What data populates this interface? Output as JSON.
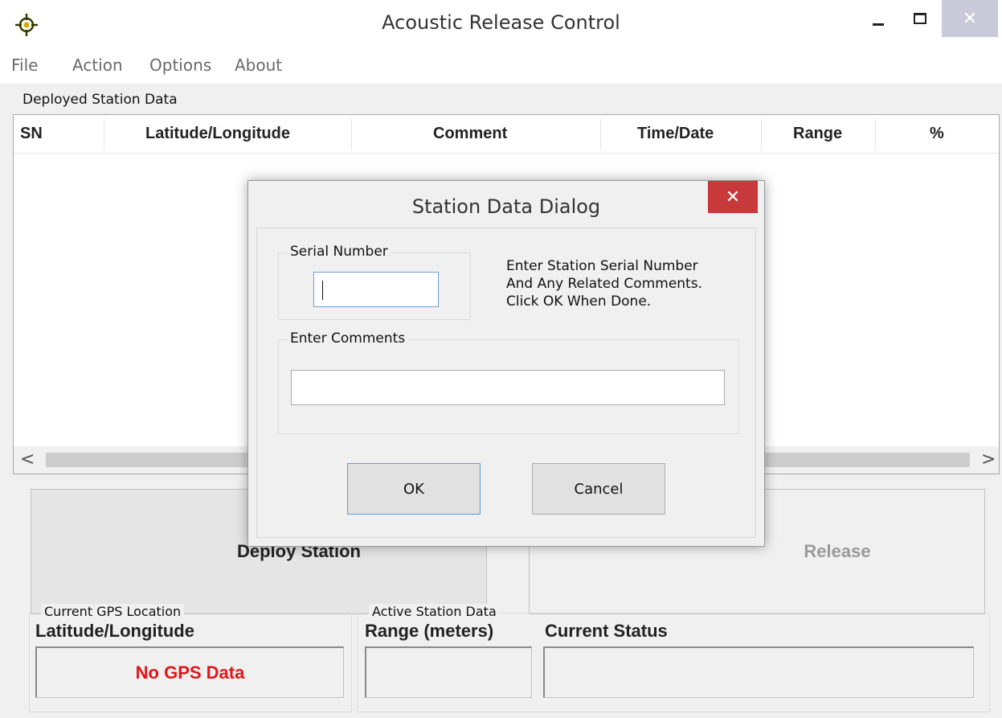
{
  "window": {
    "title": "Acoustic Release Control",
    "close_glyph": "✕",
    "icon": "crosshair-icon"
  },
  "menu": [
    "File",
    "Action",
    "Options",
    "About"
  ],
  "deployed": {
    "label": "Deployed Station Data",
    "columns": [
      "SN",
      "Latitude/Longitude",
      "Comment",
      "Time/Date",
      "Range",
      "%"
    ],
    "rows": []
  },
  "scroll": {
    "left": "<",
    "right": ">"
  },
  "buttons": {
    "deploy": "Deploy Station",
    "release": "Release"
  },
  "gps": {
    "group_label": "Current GPS Location",
    "heading": "Latitude/Longitude",
    "value": "No GPS Data"
  },
  "active": {
    "group_label": "Active Station Data",
    "range_heading": "Range (meters)",
    "range_value": "",
    "status_heading": "Current Status",
    "status_value": ""
  },
  "dialog": {
    "title": "Station Data Dialog",
    "close_glyph": "✕",
    "serial_label": "Serial Number",
    "serial_value": "",
    "hint": [
      "Enter Station Serial Number",
      "And Any Related Comments.",
      "Click OK When Done."
    ],
    "comments_label": "Enter Comments",
    "comments_value": "",
    "ok": "OK",
    "cancel": "Cancel"
  },
  "colors": {
    "gps_value": "#e0161a",
    "dialog_close": "#c7393b",
    "focus_border": "#5a9bd5"
  }
}
